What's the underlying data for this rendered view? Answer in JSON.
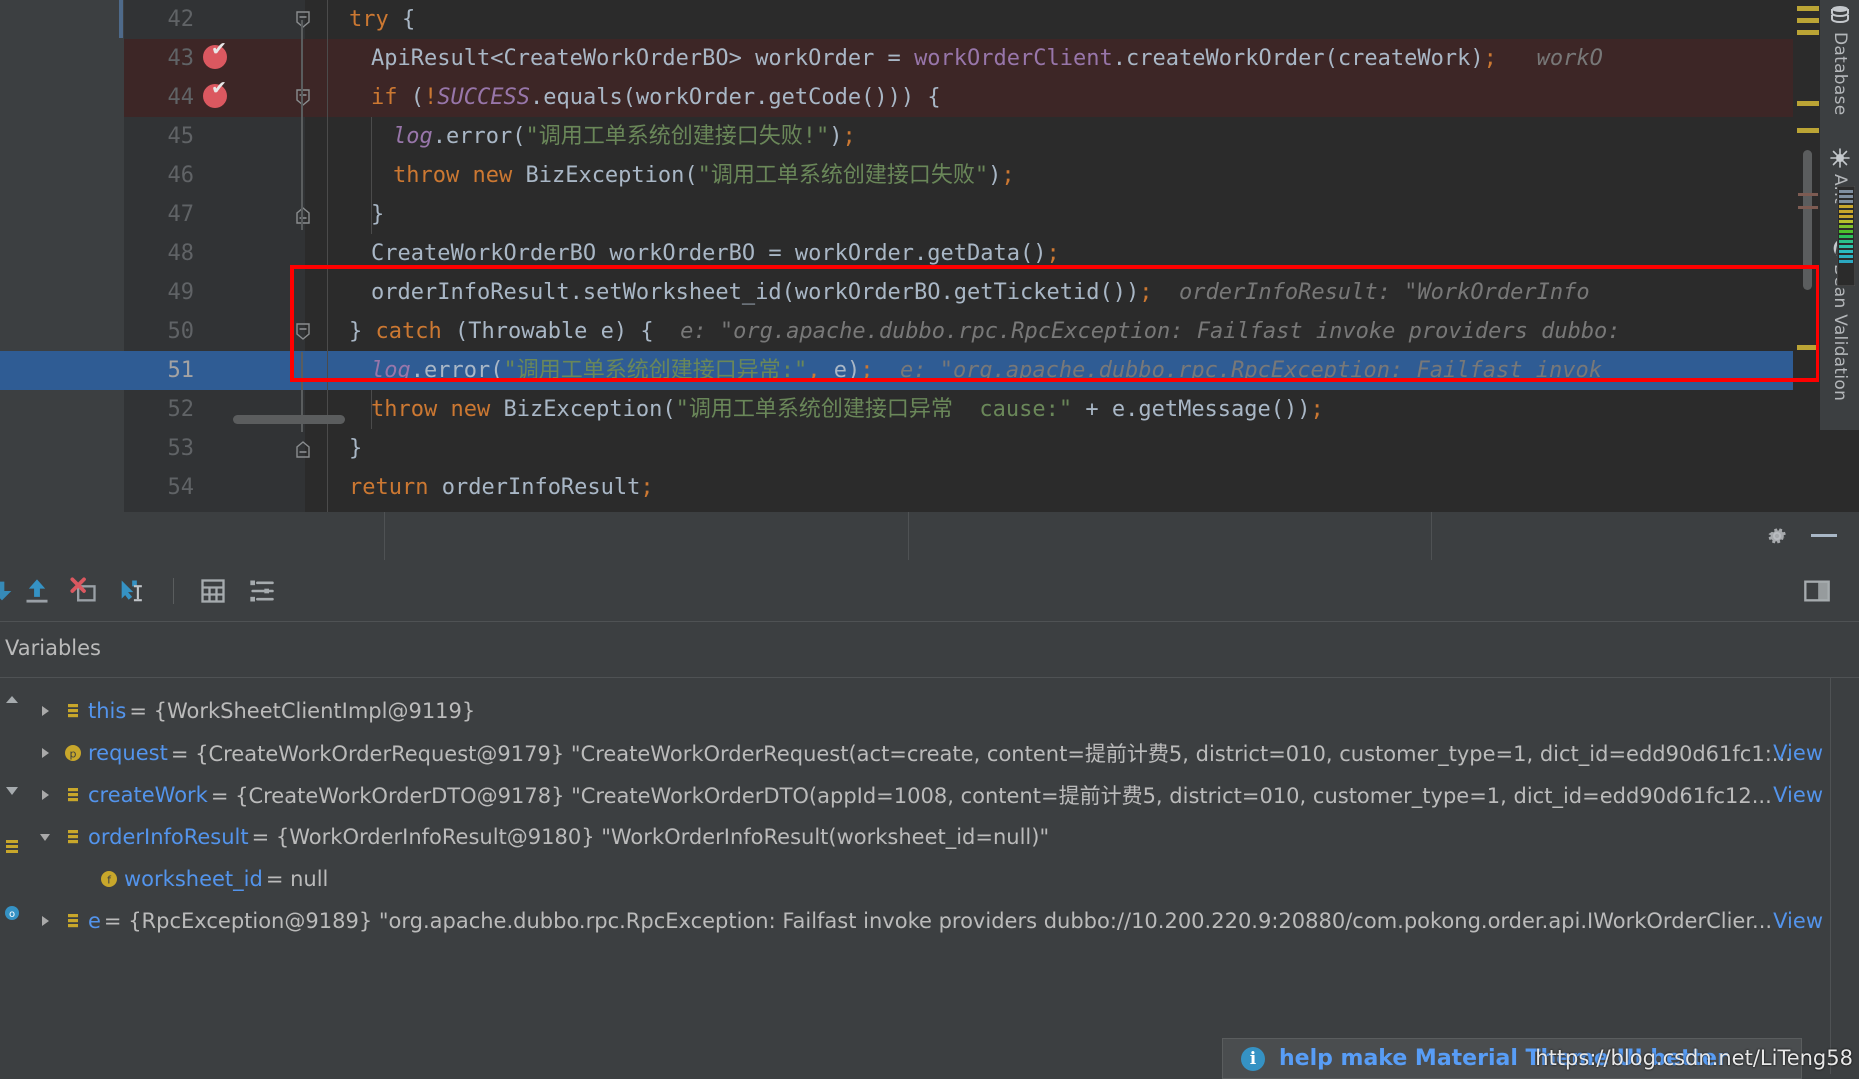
{
  "editor": {
    "lines": [
      {
        "num": "42",
        "indent": 2,
        "tokens": [
          {
            "t": "kw",
            "v": "try"
          },
          {
            "t": "plain",
            "v": " {"
          }
        ],
        "bg": "none",
        "fold": "collapse-top"
      },
      {
        "num": "43",
        "indent": 3,
        "tokens": [
          {
            "t": "plain",
            "v": "ApiResult<CreateWorkOrderBO> workOrder = "
          },
          {
            "t": "field",
            "v": "workOrderClient"
          },
          {
            "t": "plain",
            "v": ".createWorkOrder(createWork)"
          },
          {
            "t": "punc",
            "v": ";"
          },
          {
            "t": "hint",
            "v": "   workO"
          }
        ],
        "bg": "exception",
        "breakpoint": true
      },
      {
        "num": "44",
        "indent": 3,
        "tokens": [
          {
            "t": "kw",
            "v": "if"
          },
          {
            "t": "plain",
            "v": " ("
          },
          {
            "t": "punc",
            "v": "!"
          },
          {
            "t": "static",
            "v": "SUCCESS"
          },
          {
            "t": "plain",
            "v": ".equals(workOrder.getCode())) {"
          }
        ],
        "bg": "exception",
        "breakpoint": true,
        "fold": "collapse-top"
      },
      {
        "num": "45",
        "indent": 4,
        "tokens": [
          {
            "t": "fielditalic",
            "v": "log"
          },
          {
            "t": "plain",
            "v": ".error("
          },
          {
            "t": "str",
            "v": "\"调用工单系统创建接口失败!\""
          },
          {
            "t": "plain",
            "v": ")"
          },
          {
            "t": "punc",
            "v": ";"
          }
        ],
        "bg": "none"
      },
      {
        "num": "46",
        "indent": 4,
        "tokens": [
          {
            "t": "kw",
            "v": "throw new"
          },
          {
            "t": "plain",
            "v": " BizException("
          },
          {
            "t": "str",
            "v": "\"调用工单系统创建接口失败\""
          },
          {
            "t": "plain",
            "v": ")"
          },
          {
            "t": "punc",
            "v": ";"
          }
        ],
        "bg": "none"
      },
      {
        "num": "47",
        "indent": 3,
        "tokens": [
          {
            "t": "plain",
            "v": "}"
          }
        ],
        "bg": "none",
        "fold": "collapse-bottom"
      },
      {
        "num": "48",
        "indent": 3,
        "tokens": [
          {
            "t": "plain",
            "v": "CreateWorkOrderBO workOrderBO = workOrder.getData()"
          },
          {
            "t": "punc",
            "v": ";"
          }
        ],
        "bg": "none"
      },
      {
        "num": "49",
        "indent": 3,
        "tokens": [
          {
            "t": "plain",
            "v": "orderInfoResult.setWorksheet_id(workOrderBO.getTicketid())"
          },
          {
            "t": "punc",
            "v": ";"
          },
          {
            "t": "hint",
            "v": "  orderInfoResult: \"WorkOrderInfo"
          }
        ],
        "bg": "none"
      },
      {
        "num": "50",
        "indent": 2,
        "tokens": [
          {
            "t": "plain",
            "v": "} "
          },
          {
            "t": "kw",
            "v": "catch"
          },
          {
            "t": "plain",
            "v": " (Throwable e) {"
          },
          {
            "t": "hint",
            "v": "  e: \"org.apache.dubbo.rpc.RpcException: Failfast invoke providers dubbo:"
          }
        ],
        "bg": "none",
        "fold": "collapse-top"
      },
      {
        "num": "51",
        "indent": 3,
        "tokens": [
          {
            "t": "fielditalic",
            "v": "log"
          },
          {
            "t": "plain",
            "v": ".error("
          },
          {
            "t": "str",
            "v": "\"调用工单系统创建接口异常:\""
          },
          {
            "t": "punc",
            "v": ","
          },
          {
            "t": "plain",
            "v": " e)"
          },
          {
            "t": "punc",
            "v": ";"
          },
          {
            "t": "hint",
            "v": "  e: \"org.apache.dubbo.rpc.RpcException: Failfast invok"
          }
        ],
        "bg": "current"
      },
      {
        "num": "52",
        "indent": 3,
        "tokens": [
          {
            "t": "kw",
            "v": "throw new"
          },
          {
            "t": "plain",
            "v": " BizException("
          },
          {
            "t": "str",
            "v": "\"调用工单系统创建接口异常  cause:\""
          },
          {
            "t": "plain",
            "v": " + e.getMessage())"
          },
          {
            "t": "punc",
            "v": ";"
          }
        ],
        "bg": "none"
      },
      {
        "num": "53",
        "indent": 2,
        "tokens": [
          {
            "t": "plain",
            "v": "}"
          }
        ],
        "bg": "none",
        "fold": "collapse-bottom"
      },
      {
        "num": "54",
        "indent": 2,
        "tokens": [
          {
            "t": "kw",
            "v": "return"
          },
          {
            "t": "plain",
            "v": " orderInfoResult"
          },
          {
            "t": "punc",
            "v": ";"
          }
        ],
        "bg": "none"
      }
    ],
    "annotation_box_color": "#ff0000",
    "current_line_color": "#2f5c94",
    "exception_line_color": "#3d2626"
  },
  "right_tool_strip": {
    "items": [
      {
        "label": "Database",
        "icon": "database-icon"
      },
      {
        "label": "Ant",
        "icon": "ant-bug-icon"
      },
      {
        "label": "Bean Validation",
        "icon": "bean-validation-icon"
      }
    ]
  },
  "debug_toolbar": {
    "buttons": [
      {
        "name": "step-over-button",
        "icon": "step-over-icon"
      },
      {
        "name": "step-out-button",
        "icon": "step-out-icon"
      },
      {
        "name": "drop-frame-button",
        "icon": "drop-frame-icon"
      },
      {
        "name": "run-to-cursor-button",
        "icon": "run-to-cursor-icon"
      },
      {
        "name": "evaluate-expression-button",
        "icon": "calculator-icon"
      },
      {
        "name": "settings-list-button",
        "icon": "list-settings-icon"
      }
    ],
    "restore_layout_name": "restore-layout-button",
    "settings_name": "debug-settings-button",
    "minimize_name": "hide-button"
  },
  "variables_panel": {
    "title": "Variables",
    "rows": [
      {
        "expanded": false,
        "has_arrow": true,
        "indent": 0,
        "icon": "field-object-icon",
        "icon_kind": "object",
        "name": "this",
        "value": "= {WorkSheetClientImpl@9119}",
        "view_link": ""
      },
      {
        "expanded": false,
        "has_arrow": true,
        "indent": 0,
        "icon": "parameter-icon",
        "icon_kind": "param",
        "name": "request",
        "value": "= {CreateWorkOrderRequest@9179} \"CreateWorkOrderRequest(act=create, content=提前计费5, district=010, customer_type=1, dict_id=edd90d61fc1:...",
        "view_link": "View"
      },
      {
        "expanded": false,
        "has_arrow": true,
        "indent": 0,
        "icon": "field-object-icon",
        "icon_kind": "object",
        "name": "createWork",
        "value": "= {CreateWorkOrderDTO@9178} \"CreateWorkOrderDTO(appId=1008, content=提前计费5, district=010, customer_type=1, dict_id=edd90d61fc12...",
        "view_link": "View"
      },
      {
        "expanded": true,
        "has_arrow": true,
        "indent": 0,
        "icon": "field-object-icon",
        "icon_kind": "object",
        "name": "orderInfoResult",
        "value": "= {WorkOrderInfoResult@9180} \"WorkOrderInfoResult(worksheet_id=null)\"",
        "view_link": ""
      },
      {
        "expanded": false,
        "has_arrow": false,
        "indent": 1,
        "icon": "field-icon",
        "icon_kind": "field",
        "name": "worksheet_id",
        "value": "= null",
        "view_link": ""
      },
      {
        "expanded": false,
        "has_arrow": true,
        "indent": 0,
        "icon": "field-object-icon",
        "icon_kind": "object",
        "name": "e",
        "value": "= {RpcException@9189} \"org.apache.dubbo.rpc.RpcException: Failfast invoke providers dubbo://10.200.220.9:20880/com.pokong.order.api.IWorkOrderClier...",
        "view_link": "View"
      }
    ]
  },
  "notification": {
    "icon": "info-icon",
    "text": "help make Material Theme UI better",
    "glyph": "i"
  },
  "watermark": {
    "text": "https://blog.csdn.net/LiTeng58"
  },
  "colors": {
    "editor_bg": "#2b2b2b",
    "gutter_bg": "#313335",
    "panel_bg": "#3c3f41",
    "selection_blue": "#2f5c94",
    "link_blue": "#5394ec",
    "accent_red": "#ff0000",
    "breakpoint_red": "#db5860",
    "string_green": "#6a8759",
    "keyword_orange": "#cc7832",
    "field_purple": "#9876aa",
    "text_gray": "#a9b7c6"
  }
}
